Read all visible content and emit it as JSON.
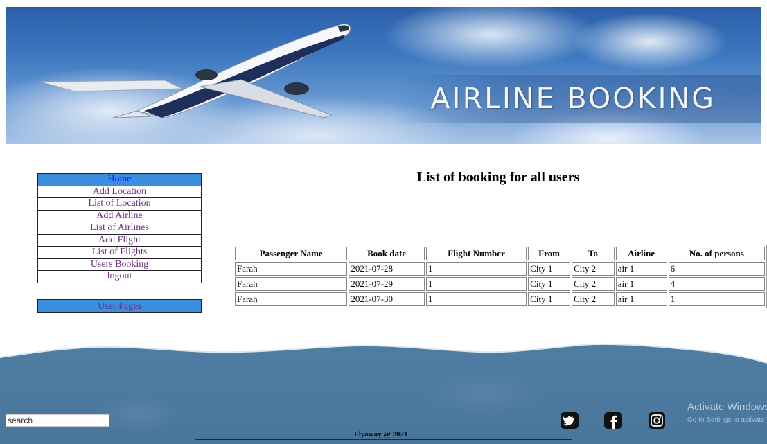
{
  "banner": {
    "title": "AIRLINE BOOKING"
  },
  "nav": {
    "items": [
      {
        "label": "Home"
      },
      {
        "label": "Add Location"
      },
      {
        "label": "List of Location"
      },
      {
        "label": "Add Airline"
      },
      {
        "label": "List of Airlines"
      },
      {
        "label": "Add Flight"
      },
      {
        "label": "List of Flights"
      },
      {
        "label": "Users Booking"
      },
      {
        "label": "logout"
      }
    ],
    "user_pages": "User Pages"
  },
  "main": {
    "title": "List of booking for all users",
    "table": {
      "headers": [
        "Passenger Name",
        "Book date",
        "Flight Number",
        "From",
        "To",
        "Airline",
        "No. of persons"
      ],
      "rows": [
        [
          "Farah",
          "2021-07-28",
          "1",
          "City 1",
          "City 2",
          "air 1",
          "6"
        ],
        [
          "Farah",
          "2021-07-29",
          "1",
          "City 1",
          "City 2",
          "air 1",
          "4"
        ],
        [
          "Farah",
          "2021-07-30",
          "1",
          "City 1",
          "City 2",
          "air 1",
          "1"
        ]
      ]
    }
  },
  "footer": {
    "search_placeholder": "search",
    "copyright": "Flyaway @ 2021",
    "social": [
      "twitter-icon",
      "facebook-icon",
      "instagram-icon"
    ]
  },
  "watermark": {
    "line1": "Activate Windows",
    "line2": "Go to Settings to activate Windows."
  },
  "colors": {
    "nav_active": "#3b8de0",
    "nav_link": "#6b2f7e",
    "footer": "#4f7ea3"
  }
}
